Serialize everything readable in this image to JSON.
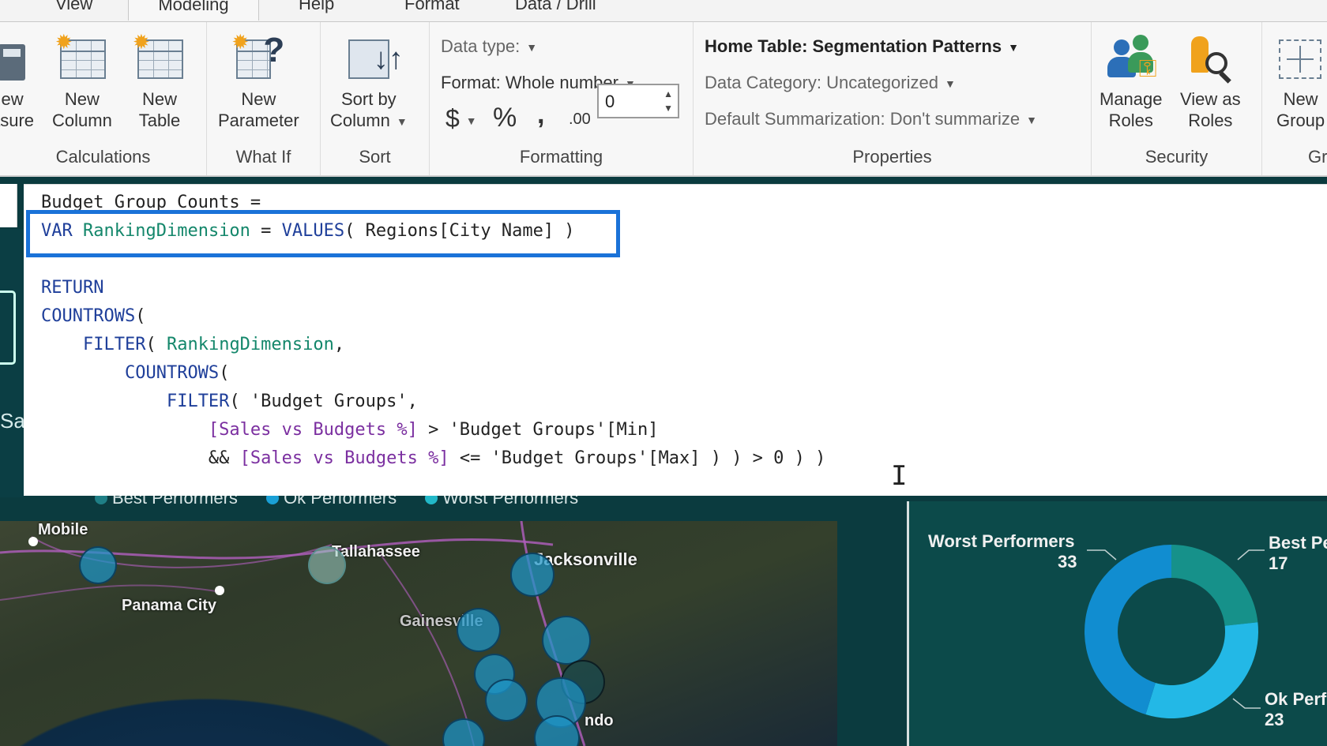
{
  "tabs": [
    "View",
    "Modeling",
    "Help",
    "Format",
    "Data / Drill"
  ],
  "active_tab": "Modeling",
  "ribbon": {
    "calculations": {
      "label": "Calculations",
      "buttons": [
        {
          "line1": "ew",
          "line2": "asure"
        },
        {
          "line1": "New",
          "line2": "Column"
        },
        {
          "line1": "New",
          "line2": "Table"
        }
      ]
    },
    "whatif": {
      "label": "What If",
      "button": {
        "line1": "New",
        "line2": "Parameter"
      }
    },
    "sort": {
      "label": "Sort",
      "button": {
        "line1": "Sort by",
        "line2": "Column"
      }
    },
    "formatting": {
      "label": "Formatting",
      "data_type": "Data type:",
      "format": "Format: Whole number",
      "currency_symbol": "$",
      "percent_symbol": "%",
      "comma_symbol": ",",
      "decimal_symbol": ".00",
      "decimal_places": "0"
    },
    "properties": {
      "label": "Properties",
      "home_table": "Home Table: Segmentation Patterns",
      "data_category": "Data Category: Uncategorized",
      "summarization": "Default Summarization: Don't summarize"
    },
    "security": {
      "label": "Security",
      "buttons": [
        {
          "line1": "Manage",
          "line2": "Roles"
        },
        {
          "line1": "View as",
          "line2": "Roles"
        }
      ]
    },
    "groups": {
      "label": "Gr",
      "button": {
        "line1": "New",
        "line2": "Group"
      }
    }
  },
  "editor": {
    "line1": "Budget Group Counts =",
    "var_kw": "VAR",
    "var_name": "RankingDimension",
    "var_eq": " = ",
    "var_fn": "VALUES",
    "var_arg": "( Regions[City Name] )",
    "return_kw": "RETURN",
    "countrows1": "COUNTROWS",
    "paren_open": "(",
    "filter1": "FILTER",
    "filter1_arg_open": "( ",
    "filter1_var": "RankingDimension",
    "filter1_comma": ",",
    "countrows2": "COUNTROWS",
    "filter2": "FILTER",
    "filter2_arg": "( 'Budget Groups',",
    "measure": "[Sales vs Budgets %]",
    "cond1_rest": " > 'Budget Groups'[Min]",
    "cond2_prefix": "&& ",
    "cond2_rest": " <= 'Budget Groups'[Max] ) ) > 0 ) )"
  },
  "canvas": {
    "left_panel_text": "Sa",
    "legend": [
      {
        "label": "Best Performers",
        "color": "#1f7f86"
      },
      {
        "label": "Ok Performers",
        "color": "#1aa0d6"
      },
      {
        "label": "Worst Performers",
        "color": "#22b8c8"
      }
    ],
    "map_labels": [
      "Mobile",
      "Tallahassee",
      "Jacksonville",
      "Panama City",
      "Gainesville",
      "ndo"
    ],
    "donut": {
      "worst_label": "Worst Performers",
      "worst_value": "33",
      "best_label": "Best Pe",
      "best_value": "17",
      "ok_label": "Ok Perf",
      "ok_value": "23",
      "colors": {
        "worst": "#118dd0",
        "best": "#16918a",
        "ok": "#23b8e6"
      }
    }
  }
}
